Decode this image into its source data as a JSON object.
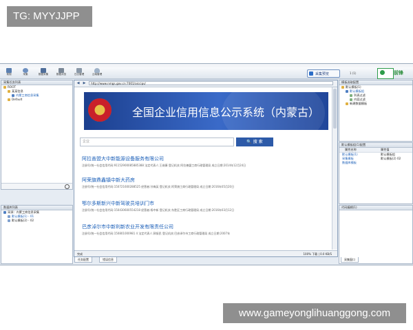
{
  "overlay": {
    "top_tag": "TG: MYYJJPP",
    "bottom_tag": "www.gameyonglihuanggong.com"
  },
  "toolbar": {
    "buttons": [
      "常规",
      "采集",
      "数据采集",
      "数据浏览",
      "日志管理",
      "云端管理"
    ],
    "collect_label": "采集预览",
    "count": "1 (1)",
    "brand_text": "前锋"
  },
  "left_top_panel": {
    "title": "采集任务列表",
    "items": [
      "ROOT",
      "某某信息",
      "内蒙工商信息采集",
      "Default"
    ]
  },
  "left_bottom_panel": {
    "title": "数据库列表",
    "items": [
      "采源：内蒙工商信息采集",
      "默认模板(1) - 01",
      "默认模板(2) - 02"
    ]
  },
  "browser": {
    "url": "http://www.nmgs.gov.cn:7001/aiccips/",
    "site_title": "全国企业信用信息公示系统（内蒙古）",
    "search_placeholder": "企业",
    "search_button": "搜 索",
    "companies": [
      {
        "name": "阿拉善盟大中新能源设备服务有限公司",
        "meta": "注册号/统一社会信用代码:91152900085885388  法定代表人:王继康  登记机关:阿拉善盟工商行政管理局  成立日期:2014年12月24日"
      },
      {
        "name": "阿荣旗鼎鑫镇中新大药房",
        "meta": "注册号/统一社会信用代码:150721600288525  经营者:孙梅英  登记机关:阿荣旗工商行政管理局  成立日期:2016年05月20日"
      },
      {
        "name": "鄂尔多斯新兴中新驾驶员培训门市",
        "meta": "注册号/统一社会信用代码:150430600554218  经营者:杨中新  登记机关:东胜区工商行政管理局  成立日期:2016年03月12日"
      },
      {
        "name": "巴彦淖尔市中新利新农业开发有限责任公司",
        "meta": "注册号/统一社会信用代码:150801000981 4  法定代表人:郭振民  登记机关:巴彦淖尔市工商行政管理局  成立日期:2007年"
      }
    ],
    "status_left": "完成",
    "status_right": "100% 下载 | 0.0 KB/S"
  },
  "bottom_tabs": [
    "任务配置",
    "错误信息"
  ],
  "right_top_panel": {
    "title": "模板选取配置",
    "items": [
      "默认模板(1)",
      "默认模板组",
      "列表过滤",
      "内容过滤",
      "新建数据模板"
    ]
  },
  "right_mid_panel": {
    "title": "默认模板组(1)配置",
    "columns": [
      "属性名称",
      "属性值"
    ],
    "rows": [
      [
        "默认模板(1)",
        "默认模板组"
      ],
      [
        "采集模板",
        "默认模板(2) 02"
      ],
      [
        "数据库模板",
        ""
      ]
    ]
  },
  "right_bottom_panel": {
    "title": "代码编辑(1)",
    "footer_tab": "采集窗口"
  },
  "colors": {
    "banner": "#2a55b0",
    "link": "#1b5fb8",
    "search_button": "#2d5aa8",
    "brand_green": "#2a8c3a",
    "app_bg": "#e6ecf3"
  },
  "icons": [
    "back-arrow-icon",
    "forward-arrow-icon",
    "emblem-icon",
    "folder-icon",
    "gear-icon",
    "cloud-icon"
  ]
}
